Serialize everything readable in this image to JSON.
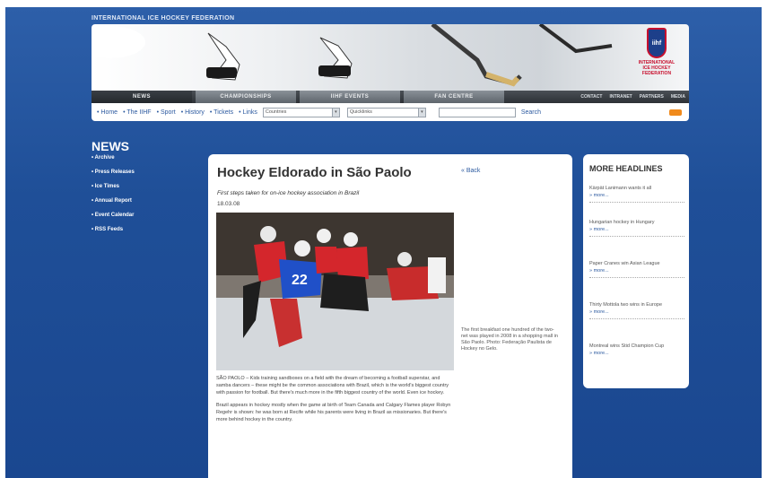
{
  "header": {
    "org_title": "INTERNATIONAL ICE HOCKEY FEDERATION",
    "logo_letters": "iihf",
    "logo_text": "INTERNATIONAL ICE HOCKEY FEDERATION"
  },
  "nav": {
    "tabs": [
      "NEWS",
      "CHAMPIONSHIPS",
      "IIHF EVENTS",
      "FAN CENTRE"
    ],
    "links": [
      "CONTACT",
      "INTRANET",
      "PARTNERS",
      "MEDIA"
    ]
  },
  "subnav": {
    "links": [
      "• Home",
      "• The IIHF",
      "• Sport",
      "• History",
      "• Tickets",
      "• Links"
    ],
    "select1": "Countries",
    "select2": "Quicklinks",
    "search_label": "Search"
  },
  "news": {
    "heading": "NEWS",
    "items": [
      "• Archive",
      "• Press Releases",
      "• Ice Times",
      "• Annual Report",
      "• Event Calendar",
      "• RSS Feeds"
    ]
  },
  "article": {
    "title": "Hockey Eldorado in São Paolo",
    "back": "« Back",
    "subtitle": "First steps taken for on-ice hockey association in Brazil",
    "date": "18.03.08",
    "caption": "The first breakfast one hundred of the two-net was played in 2008 in a shopping mall in São Paolo. Photo: Federação Paulista de Hockey no Gelo.",
    "paragraphs": [
      "SÃO PAOLO – Kids training sandboxes on a field with the dream of becoming a football superstar, and samba dancers – these might be the common associations with Brazil, which is the world's biggest country with passion for football. But there's much more in the fifth biggest country of the world. Even ice hockey.",
      "Brazil appears in hockey mostly when the game at birth of Team Canada and Calgary Flames player Robyn Regehr is shown: he was born at Recife while his parents were living in Brazil as missionaries. But there's more behind hockey in the country."
    ]
  },
  "headlines": {
    "heading": "MORE HEADLINES",
    "items": [
      {
        "text": "Kärpät Lanimann wants it all",
        "more": "» more..."
      },
      {
        "text": "Hungarian hockey in Hungary",
        "more": "» more..."
      },
      {
        "text": "Paper Cranes win Asian League",
        "more": "» more..."
      },
      {
        "text": "Thirty Mottola two wins in Europe",
        "more": "» more..."
      },
      {
        "text": "Montreal wins Stid Champion Cup",
        "more": "» more..."
      }
    ]
  }
}
